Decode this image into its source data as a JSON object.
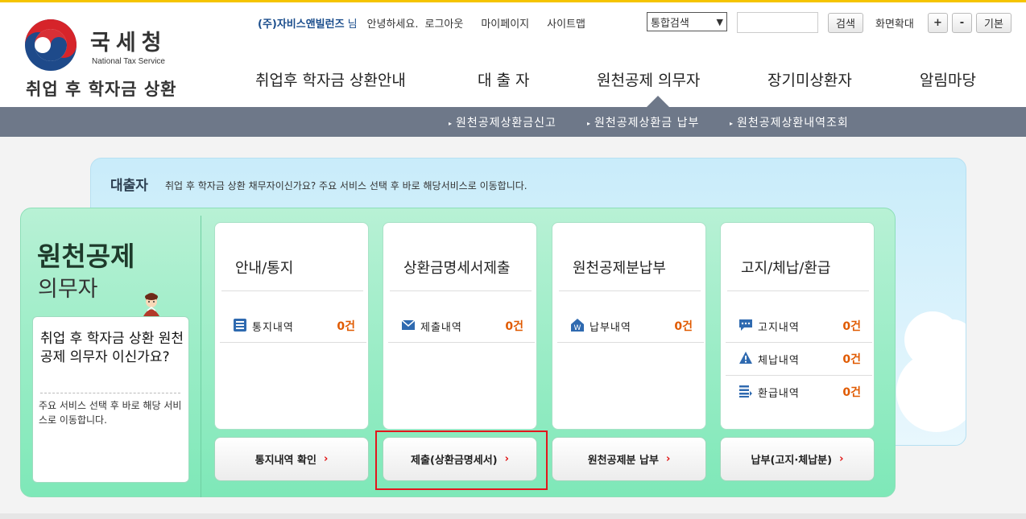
{
  "header": {
    "logo": {
      "org_ko": "국세청",
      "org_en": "National Tax Service",
      "service": "취업 후 학자금 상환"
    },
    "util": {
      "user_name": "(주)자비스앤빌런즈",
      "user_suffix": "님",
      "greeting": "안녕하세요.",
      "logout": "로그아웃",
      "mypage": "마이페이지",
      "sitemap": "사이트맵"
    },
    "search": {
      "select_value": "통합검색",
      "input_value": "",
      "button": "검색"
    },
    "zoom": {
      "label": "화면확대",
      "plus": "+",
      "minus": "-",
      "reset": "기본"
    },
    "gnb": [
      "취업후 학자금 상환안내",
      "대 출 자",
      "원천공제 의무자",
      "장기미상환자",
      "알림마당"
    ],
    "gnb_active": "원천공제 의무자",
    "subnav": [
      "원천공제상환금신고",
      "원천공제상환금 납부",
      "원천공제상환내역조회"
    ]
  },
  "banner": {
    "title": "대출자",
    "desc": "취업 후 학자금 상환 채무자이신가요? 주요 서비스 선택 후 바로 해당서비스로 이동합니다."
  },
  "side": {
    "title1": "원천공제",
    "title2": "의무자",
    "question": "취업 후 학자금 상환 원천공제 의무자 이신가요?",
    "desc": "주요 서비스 선택 후 바로 해당 서비스로 이동합니다."
  },
  "cards": [
    {
      "title": "안내/통지",
      "rows": [
        {
          "icon": "list-icon",
          "label": "통지내역",
          "value": "0건"
        }
      ],
      "button": "통지내역 확인"
    },
    {
      "title": "상환금명세서제출",
      "rows": [
        {
          "icon": "mail-icon",
          "label": "제출내역",
          "value": "0건"
        }
      ],
      "button": "제출(상환금명세서)"
    },
    {
      "title": "원천공제분납부",
      "rows": [
        {
          "icon": "won-house-icon",
          "label": "납부내역",
          "value": "0건"
        }
      ],
      "button": "원천공제분 납부"
    },
    {
      "title": "고지/체납/환급",
      "rows": [
        {
          "icon": "speech-bubble-icon",
          "label": "고지내역",
          "value": "0건"
        },
        {
          "icon": "warning-icon",
          "label": "체납내역",
          "value": "0건"
        },
        {
          "icon": "refund-list-icon",
          "label": "환급내역",
          "value": "0건"
        }
      ],
      "button": "납부(고지·체납분)"
    }
  ],
  "colors": {
    "subnav_bg": "#6e7889",
    "count": "#e05a00",
    "chevron": "#e01010",
    "highlight": "#e3161c"
  }
}
